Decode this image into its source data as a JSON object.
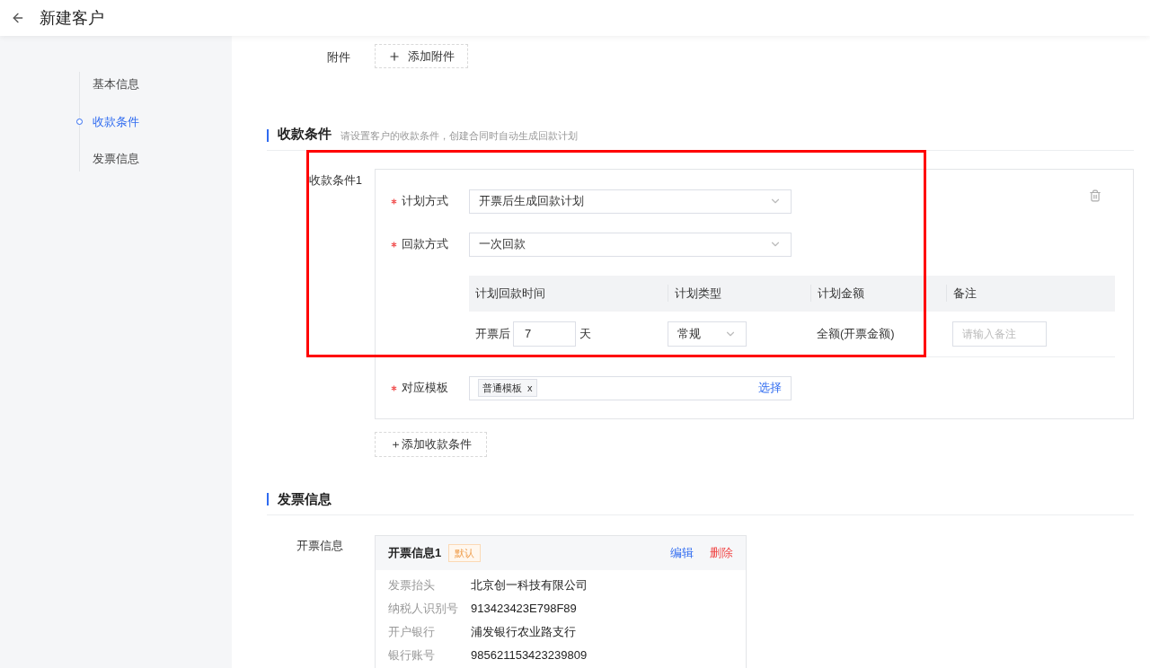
{
  "header": {
    "title": "新建客户"
  },
  "nav": {
    "items": [
      {
        "label": "基本信息",
        "selected": false
      },
      {
        "label": "收款条件",
        "selected": true
      },
      {
        "label": "发票信息",
        "selected": false
      }
    ]
  },
  "attachment": {
    "label": "附件",
    "button": "添加附件"
  },
  "payment_section": {
    "title": "收款条件",
    "hint": "请设置客户的收款条件，创建合同时自动生成回款计划",
    "conditions": [
      {
        "label": "收款条件1",
        "fields": [
          {
            "label": "计划方式",
            "required": true,
            "value": "开票后生成回款计划"
          },
          {
            "label": "回款方式",
            "required": true,
            "value": "一次回款"
          }
        ],
        "table": {
          "columns": [
            "计划回款时间",
            "计划类型",
            "计划金额",
            "备注"
          ],
          "rows": [
            {
              "prefix": "开票后",
              "days": "7",
              "unit": "天",
              "type": "常规",
              "amount": "全额(开票金额)",
              "remark_placeholder": "请输入备注"
            }
          ]
        },
        "template": {
          "label": "对应模板",
          "required": true,
          "tags": [
            {
              "label": "普通模板",
              "remove": "x"
            }
          ],
          "action": "选择"
        }
      }
    ],
    "add_button": "＋添加收款条件"
  },
  "invoice_section": {
    "title": "发票信息",
    "label": "开票信息",
    "cards": [
      {
        "title": "开票信息1",
        "badge": "默认",
        "actions": [
          {
            "label": "编辑",
            "kind": "edit"
          },
          {
            "label": "删除",
            "kind": "delete"
          }
        ],
        "rows": [
          {
            "label": "发票抬头",
            "value": "北京创一科技有限公司"
          },
          {
            "label": "纳税人识别号",
            "value": "913423423E798F89"
          },
          {
            "label": "开户银行",
            "value": "浦发银行农业路支行"
          },
          {
            "label": "银行账号",
            "value": "985621153423239809"
          }
        ]
      }
    ]
  }
}
